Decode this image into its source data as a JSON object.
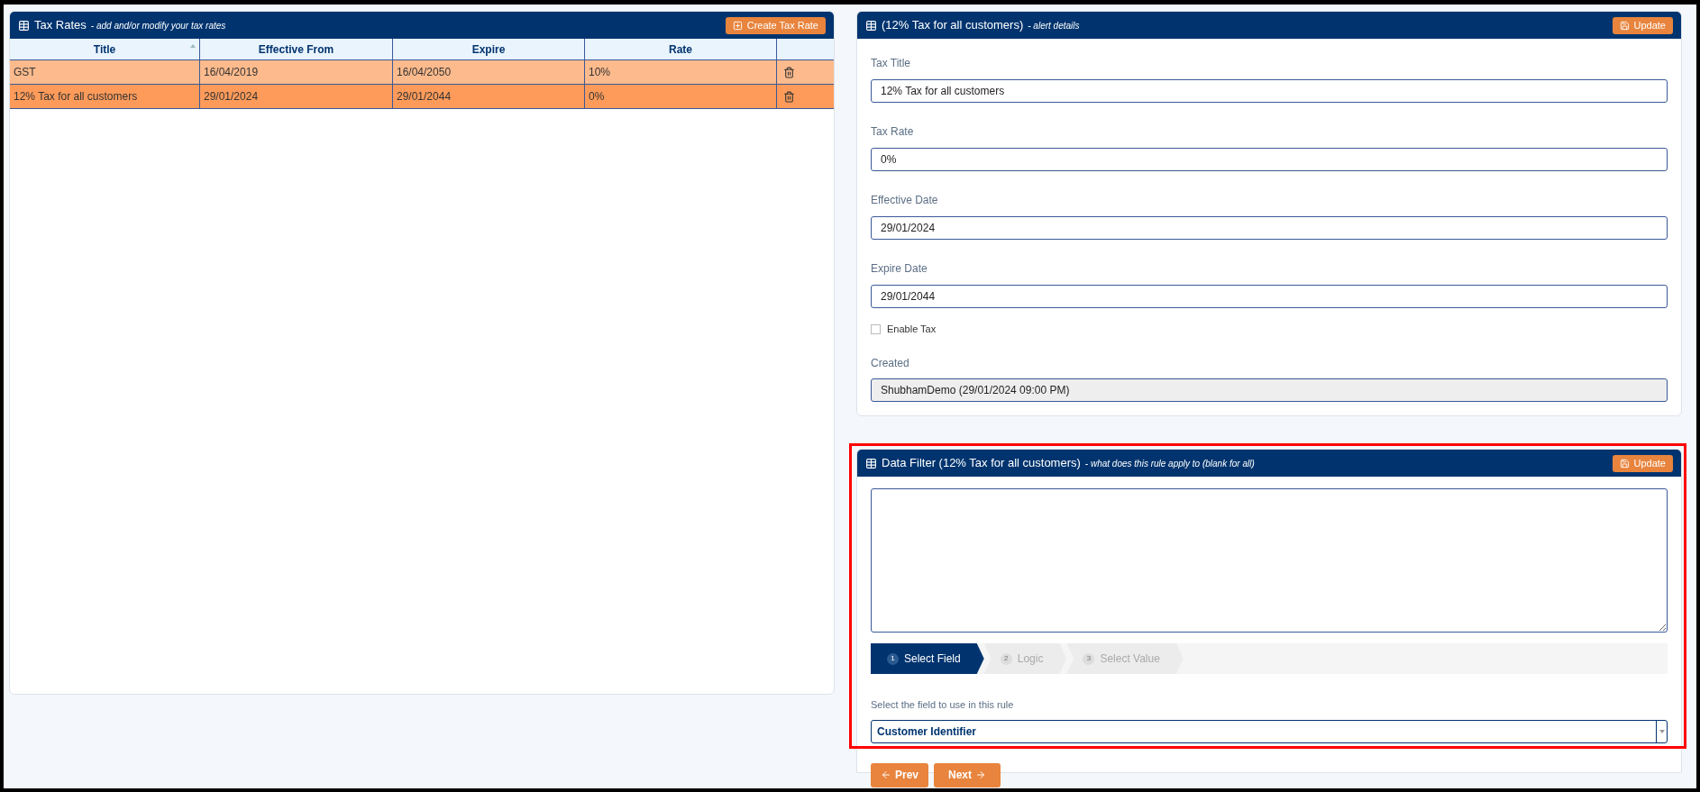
{
  "tax_rates": {
    "title": "Tax Rates",
    "subtitle": "- add and/or modify your tax rates",
    "create_button": "Create Tax Rate",
    "columns": [
      "Title",
      "Effective From",
      "Expire",
      "Rate"
    ],
    "rows": [
      {
        "cells": [
          "GST",
          "16/04/2019",
          "16/04/2050",
          "10%"
        ],
        "selected": false
      },
      {
        "cells": [
          "12% Tax for all customers",
          "29/01/2024",
          "29/01/2044",
          "0%"
        ],
        "selected": true
      }
    ]
  },
  "details": {
    "title": "(12% Tax for all customers)",
    "subtitle": "- alert details",
    "update_button": "Update",
    "fields": [
      {
        "kind": "text",
        "label": "Tax Title",
        "value": "12% Tax for all customers"
      },
      {
        "kind": "text",
        "label": "Tax Rate",
        "value": "0%"
      },
      {
        "kind": "text",
        "label": "Effective Date",
        "value": "29/01/2024"
      },
      {
        "kind": "text",
        "label": "Expire Date",
        "value": "29/01/2044"
      },
      {
        "kind": "checkbox",
        "label": "Enable Tax",
        "checked": false
      },
      {
        "kind": "readonly",
        "label": "Created",
        "value": "ShubhamDemo (29/01/2024 09:00 PM)"
      }
    ]
  },
  "data_filter": {
    "title": "Data Filter (12% Tax for all customers)",
    "subtitle": "- what does this rule apply to (blank for all)",
    "update_button": "Update",
    "steps": [
      {
        "number": "1",
        "label": "Select Field",
        "selected": true
      },
      {
        "number": "2",
        "label": "Logic",
        "selected": false
      },
      {
        "number": "3",
        "label": "Select Value",
        "selected": false
      }
    ],
    "select_label": "Select the field to use in this rule",
    "select_value": "Customer Identifier",
    "prev_button": "Prev",
    "next_button": "Next"
  },
  "highlight": true
}
